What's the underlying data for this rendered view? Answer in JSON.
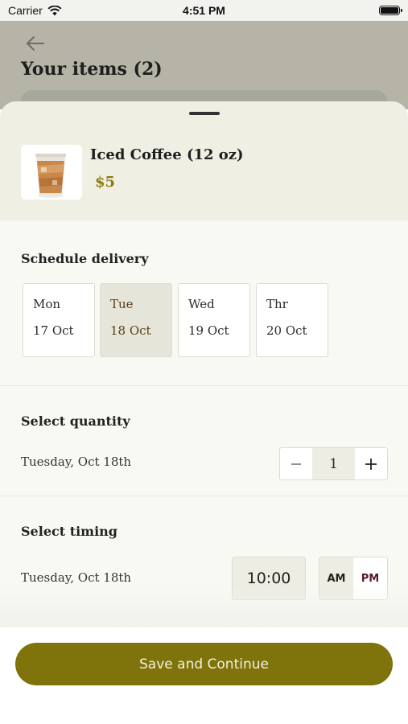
{
  "status_bar": {
    "carrier": "Carrier",
    "time": "4:51 PM",
    "wifi_icon": "wifi-icon",
    "battery_icon": "battery-icon"
  },
  "header": {
    "title": "Your items (2)",
    "back_icon": "arrow-left-icon"
  },
  "item": {
    "name": "Iced Coffee  (12 oz)",
    "price": "$5",
    "image_icon": "iced-coffee-image"
  },
  "schedule": {
    "title": "Schedule delivery",
    "days": [
      {
        "day": "Mon",
        "date": "17 Oct",
        "selected": false
      },
      {
        "day": "Tue",
        "date": "18 Oct",
        "selected": true
      },
      {
        "day": "Wed",
        "date": "19 Oct",
        "selected": false
      },
      {
        "day": "Thr",
        "date": "20 Oct",
        "selected": false
      }
    ]
  },
  "quantity": {
    "title": "Select quantity",
    "date_label": "Tuesday, Oct 18th",
    "value": "1",
    "minus_icon": "minus-icon",
    "plus_icon": "plus-icon"
  },
  "timing": {
    "title": "Select timing",
    "date_label": "Tuesday, Oct 18th",
    "time": "10:00",
    "am": "AM",
    "pm": "PM",
    "selected_period": "AM"
  },
  "footer": {
    "button_label": "Save and Continue"
  },
  "colors": {
    "accent": "#7f730c",
    "price": "#8a7a10",
    "selected_bg": "#e6e5d9",
    "backdrop": "#b5b4a6"
  }
}
